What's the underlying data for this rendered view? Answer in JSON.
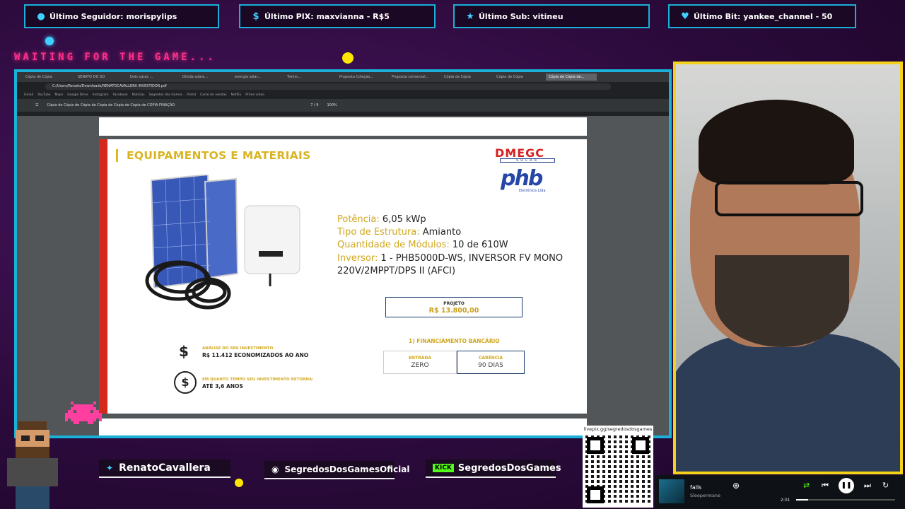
{
  "alerts": [
    {
      "label": "Último Seguidor: morispylips",
      "icon": "person-icon"
    },
    {
      "label": "Último PIX: maxvianna - R$5",
      "icon": "dollar-icon"
    },
    {
      "label": "Último Sub: vitineu",
      "icon": "star-icon"
    },
    {
      "label": "Último Bit: yankee_channel - 50",
      "icon": "heart-icon"
    }
  ],
  "waiting_text": "WAITING FOR THE GAME...",
  "browser": {
    "tabs": [
      "Cópia de Cópia",
      "SENATO DO SO",
      "Dois caras ...",
      "Dívida sobre...",
      "energia solar...",
      "Treino...",
      "Proposta Coleção...",
      "Proposta comercial...",
      "Cópia de Cópia",
      "Cópia de Cópia",
      "Cópia de Cópia de..."
    ],
    "url": "C:/Users/Renato/Downloads/RENATOCAVALLERA INVESTIDOR.pdf",
    "bookmarks": [
      "Gmail",
      "YouTube",
      "Maps",
      "Google Drive",
      "Instagram",
      "Facebook",
      "Notícias",
      "Segredos dos Games",
      "Portal",
      "Canal de vendas",
      "Netflix",
      "Prime video"
    ],
    "pdf_name": "Cópia de Cópia de Cópia de Cópia de Cópia de Cópia de COPIA FINAÇÃO",
    "page_indicator": "7 / 9",
    "zoom": "100%"
  },
  "slide": {
    "title": "EQUIPAMENTOS E MATERIAIS",
    "logo1": "DMEGC",
    "logo1_sub": "SOLAR",
    "logo2": "phb",
    "logo2_sub": "Eletrônica Ltda",
    "specs": [
      {
        "key": "Potência:",
        "value": "6,05 kWp"
      },
      {
        "key": "Tipo de Estrutura:",
        "value": "Amianto"
      },
      {
        "key": "Quantidade de Módulos:",
        "value": "10 de 610W"
      },
      {
        "key": "Inversor:",
        "value": "1 - PHB5000D-WS, INVERSOR FV MONO 220V/2MPPT/DPS II (AFCI)"
      }
    ],
    "project_label": "PROJETO",
    "project_value": "R$ 13.800,00",
    "financing_title": "1) FINANCIAMENTO BANCÁRIO",
    "entry_label": "ENTRADA",
    "entry_value": "ZERO",
    "grace_label": "CARÊNCIA",
    "grace_value": "90 DIAS",
    "analysis_label": "ANÁLISE DO SEU INVESTIMENTO",
    "analysis_value": "R$ 11.412 ECONOMIZADOS AO ANO",
    "return_label": "EM QUANTO TEMPO SEU INVESTIMENTO RETORNA:",
    "return_value": "ATÉ 3,6 ANOS"
  },
  "socials": [
    {
      "icon": "twitter-icon",
      "label": "RenatoCavallera"
    },
    {
      "icon": "instagram-icon",
      "label": "SegredosDosGamesOficial"
    },
    {
      "icon": "kick-icon",
      "badge": "KICK",
      "label": "SegredosDosGames"
    }
  ],
  "qr_label": "livepix.gg/segredosdosgames",
  "player": {
    "song": "falls",
    "artist": "Sleepermane",
    "time": "2:01",
    "progress": 0.12
  },
  "colors": {
    "accent_cyan": "#1ab0d8",
    "webcam_border": "#f4d21a",
    "slide_gold": "#d0a81e",
    "slide_red": "#d42a1e",
    "neon_pink": "#ff2f8a"
  }
}
